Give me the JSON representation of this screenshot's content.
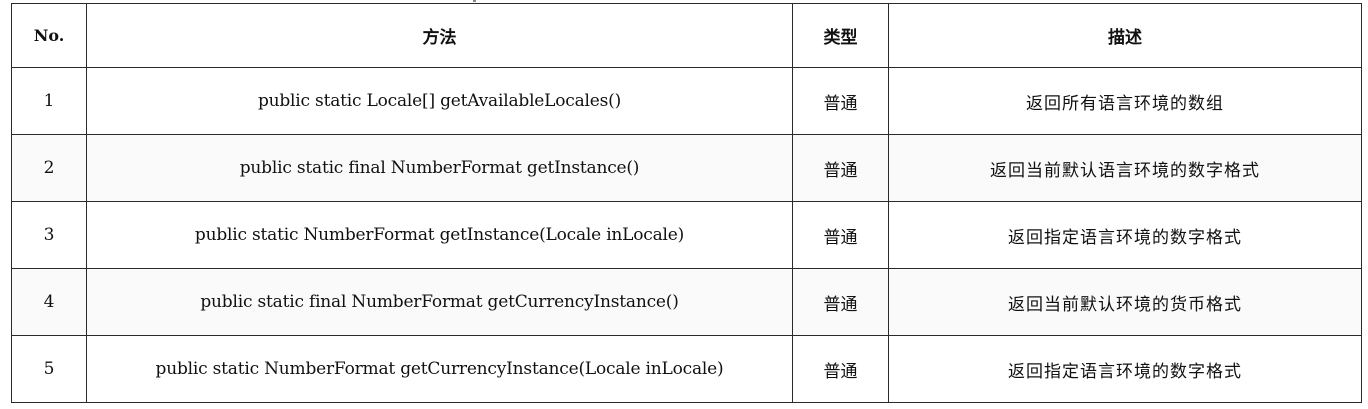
{
  "table": {
    "headers": {
      "no": "No.",
      "method": "方法",
      "type": "类型",
      "description": "描述"
    },
    "rows": [
      {
        "no": "1",
        "method": "public static Locale[] getAvailableLocales()",
        "type": "普通",
        "description": "返回所有语言环境的数组"
      },
      {
        "no": "2",
        "method": "public static final NumberFormat getInstance()",
        "type": "普通",
        "description": "返回当前默认语言环境的数字格式"
      },
      {
        "no": "3",
        "method": "public static NumberFormat getInstance(Locale inLocale)",
        "type": "普通",
        "description": "返回指定语言环境的数字格式"
      },
      {
        "no": "4",
        "method": "public static final NumberFormat getCurrencyInstance()",
        "type": "普通",
        "description": "返回当前默认环境的货币格式"
      },
      {
        "no": "5",
        "method": "public static NumberFormat getCurrencyInstance(Locale inLocale)",
        "type": "普通",
        "description": "返回指定语言环境的数字格式"
      }
    ]
  }
}
